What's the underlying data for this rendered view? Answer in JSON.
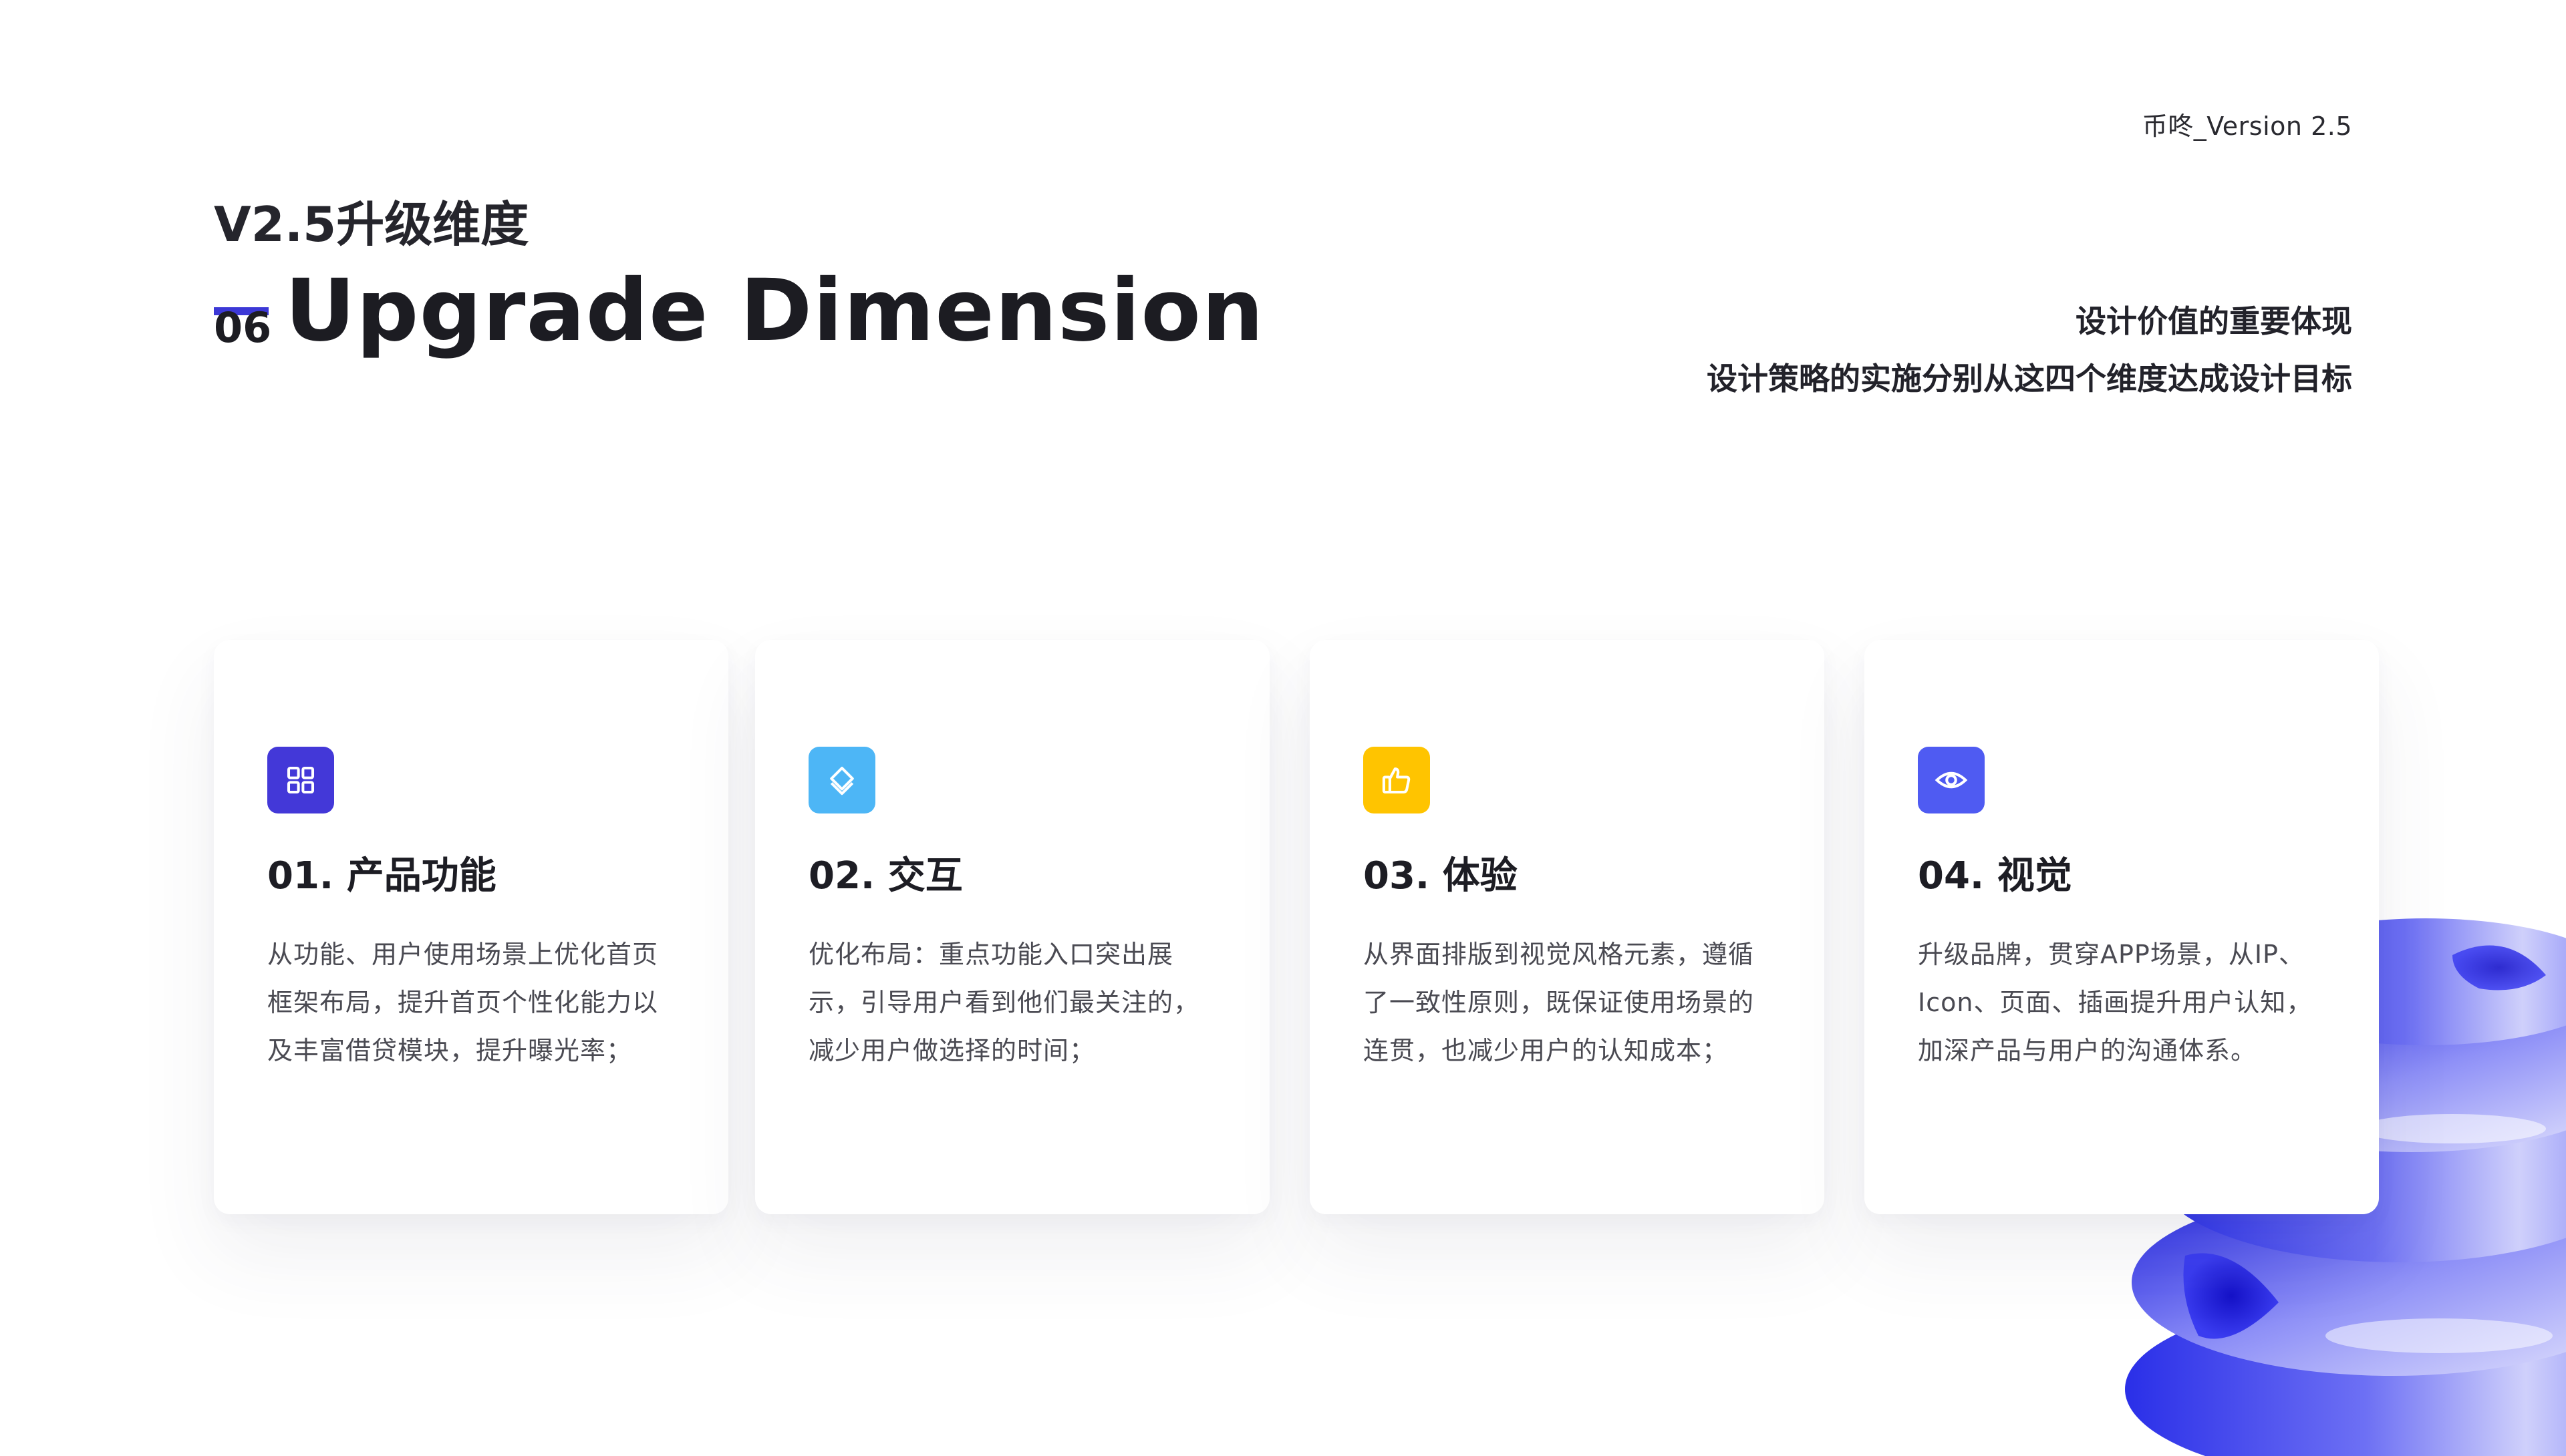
{
  "header": {
    "version": "币咚_Version 2.5",
    "subtitle": "V2.5升级维度",
    "section_number": "06",
    "title": "Upgrade Dimension"
  },
  "description": {
    "line1": "设计价值的重要体现",
    "line2": "设计策略的实施分别从这四个维度达成设计目标"
  },
  "colors": {
    "accent": "#3c38d6",
    "icon_product": "#4338d8",
    "icon_interaction": "#4db6f6",
    "icon_experience": "#ffc400",
    "icon_visual": "#4f5bf2"
  },
  "cards": [
    {
      "icon": "grid-icon",
      "title": "01. 产品功能",
      "lines": [
        "从功能、用户使用场景上优化首页",
        "框架布局，提升首页个性化能力以",
        "及丰富借贷模块，提升曝光率；"
      ]
    },
    {
      "icon": "layers-icon",
      "title": "02. 交互",
      "lines": [
        "优化布局：重点功能入口突出展",
        "示，引导用户看到他们最关注的，",
        "减少用户做选择的时间；"
      ]
    },
    {
      "icon": "thumbs-up-icon",
      "title": "03. 体验",
      "lines": [
        "从界面排版到视觉风格元素，遵循",
        "了一致性原则，既保证使用场景的",
        "连贯，也减少用户的认知成本；"
      ]
    },
    {
      "icon": "eye-icon",
      "title": "04. 视觉",
      "lines": [
        "升级品牌，贯穿APP场景，从IP、",
        "Icon、页面、插画提升用户认知，",
        "加深产品与用户的沟通体系。"
      ]
    }
  ]
}
